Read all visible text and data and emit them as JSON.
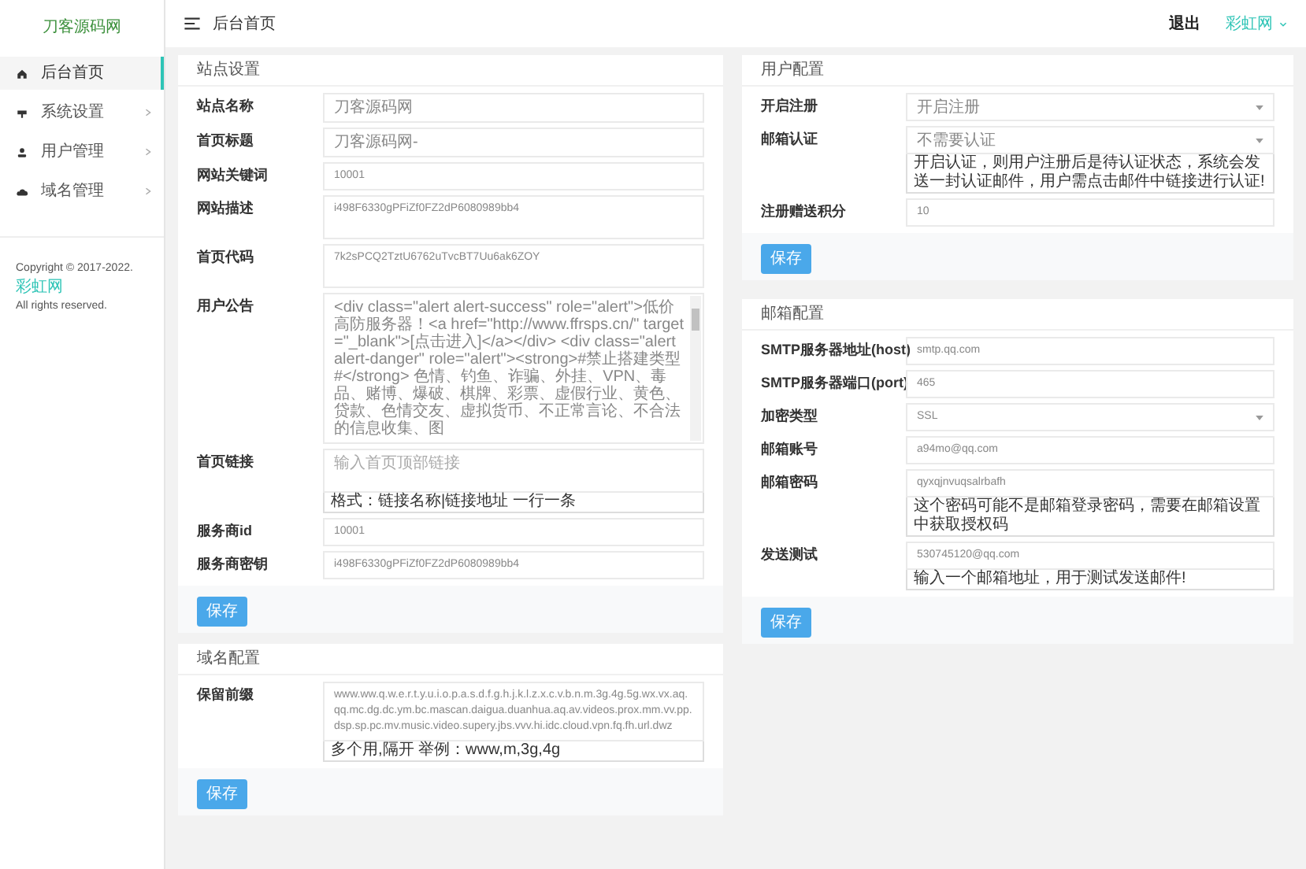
{
  "sidebar": {
    "logo_alt": "刀客源码网",
    "items": [
      {
        "label": "后台首页",
        "selected": true,
        "expandable": false
      },
      {
        "label": "系统设置",
        "selected": false,
        "expandable": true
      },
      {
        "label": "用户管理",
        "selected": false,
        "expandable": true
      },
      {
        "label": "域名管理",
        "selected": false,
        "expandable": true
      }
    ],
    "copyright": {
      "text": "Copyright © 2017-2022.",
      "link": "彩虹网",
      "line2": "All rights reserved."
    }
  },
  "header": {
    "title": "后台首页",
    "logout": "退出",
    "user": "彩虹网"
  },
  "left_column": [
    {
      "title": "站点设置",
      "button": "保存",
      "fields": [
        {
          "label": "站点名称",
          "kind": "input",
          "value": "刀客源码网"
        },
        {
          "label": "首页标题",
          "kind": "input",
          "value": "刀客源码网-"
        },
        {
          "label": "网站关键词",
          "kind": "input",
          "value": "10001"
        },
        {
          "label": "网站描述",
          "kind": "textarea",
          "value": "i498F6330gPFiZf0FZ2dP6080989bb4"
        },
        {
          "label": "首页代码",
          "kind": "textarea",
          "value": "7k2sPCQ2TztU6762uTvcBT7Uu6ak6ZOY"
        },
        {
          "label": "用户公告",
          "kind": "scroll",
          "value": "<div class=\"alert alert-success\" role=\"alert\">低价高防服务器！<a href=\"http://www.ffrsps.cn/\" target=\"_blank\">[点击进入]</a></div> <div class=\"alert alert-danger\" role=\"alert\"><strong>#禁止搭建类型#</strong> 色情、钓鱼、诈骗、外挂、VPN、毒品、赌博、爆破、棋牌、彩票、虚假行业、黄色、贷款、色情交友、虚拟货币、不正常言论、不合法的信息收集、图"
        },
        {
          "label": "首页链接",
          "kind": "textarea",
          "placeholder": "输入首页顶部链接",
          "help": "格式：链接名称|链接地址 一行一条"
        },
        {
          "label": "服务商id",
          "kind": "input",
          "value": "10001"
        },
        {
          "label": "服务商密钥",
          "kind": "input",
          "value": "i498F6330gPFiZf0FZ2dP6080989bb4"
        }
      ]
    },
    {
      "title": "域名配置",
      "button": "保存",
      "fields": [
        {
          "label": "保留前缀",
          "kind": "textarea",
          "value": "www.ww.q.w.e.r.t.y.u.i.o.p.a.s.d.f.g.h.j.k.l.z.x.c.v.b.n.m.3g.4g.5g.wx.vx.aq.qq.mc.dg.dc.ym.bc.mascan.daigua.duanhua.aq.av.videos.prox.mm.vv.pp.dsp.sp.pc.mv.music.video.supery.jbs.vvv.hi.idc.cloud.vpn.fq.fh.url.dwz",
          "help": "多个用,隔开 举例：www,m,3g,4g"
        }
      ]
    }
  ],
  "right_column": [
    {
      "title": "用户配置",
      "button": "保存",
      "fields": [
        {
          "label": "开启注册",
          "kind": "select",
          "value": "开启注册"
        },
        {
          "label": "邮箱认证",
          "kind": "select",
          "value": "不需要认证",
          "help": "开启认证，则用户注册后是待认证状态，系统会发送一封认证邮件，用户需点击邮件中链接进行认证!"
        },
        {
          "label": "注册赠送积分",
          "kind": "input",
          "value": "10"
        }
      ]
    },
    {
      "title": "邮箱配置",
      "button": "保存",
      "fields": [
        {
          "label": "SMTP服务器地址(host)",
          "kind": "input",
          "value": "smtp.qq.com"
        },
        {
          "label": "SMTP服务器端口(port)",
          "kind": "input",
          "value": "465"
        },
        {
          "label": "加密类型",
          "kind": "select",
          "value": "SSL"
        },
        {
          "label": "邮箱账号",
          "kind": "input",
          "value": "a94mo@qq.com"
        },
        {
          "label": "邮箱密码",
          "kind": "input",
          "value": "qyxqjnvuqsalrbafh",
          "help": "这个密码可能不是邮箱登录密码，需要在邮箱设置中获取授权码"
        },
        {
          "label": "发送测试",
          "kind": "input",
          "value": "530745120@qq.com",
          "help": "输入一个邮箱地址，用于测试发送邮件!"
        }
      ]
    }
  ]
}
